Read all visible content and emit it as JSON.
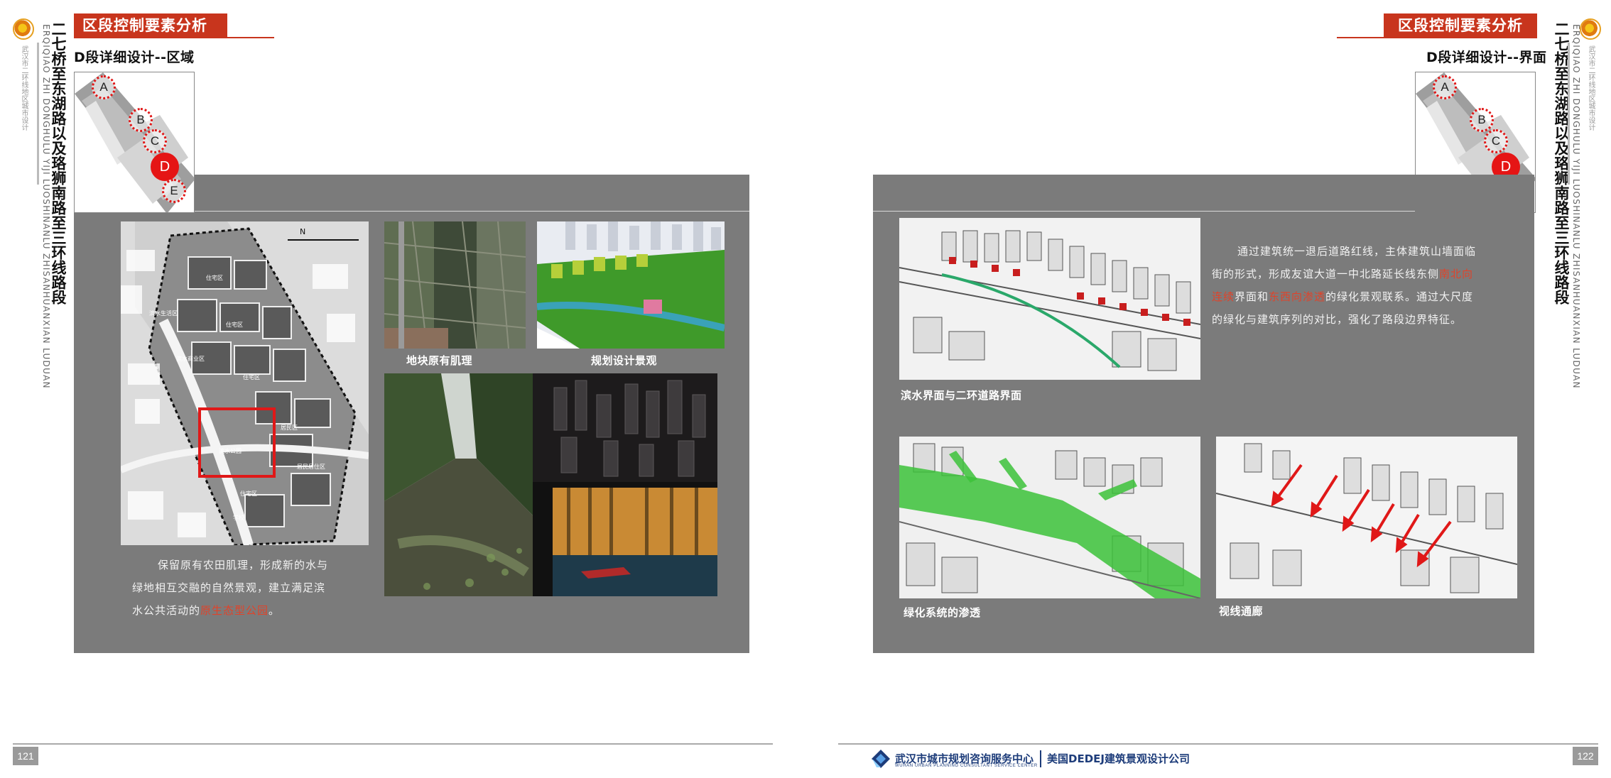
{
  "left_page": {
    "side": {
      "org_small": "武汉市二环线地区城市设计",
      "title": "二七桥至东湖路以及珞狮南路至三环线路段",
      "title_latin": "ERQIQIAO ZHI DONGHULU YIJI LUOSHINANLU ZHISANHUANXIAN LUDUAN"
    },
    "badge": "区段控制要素分析",
    "subtitle": "D段详细设计--区域",
    "keymap_markers": [
      "A",
      "B",
      "C",
      "D",
      "E"
    ],
    "plan_labels": [
      "住宅区",
      "滨水生活区",
      "住宅区",
      "滨水商业区",
      "住宅区",
      "滨水公园",
      "居民区",
      "居民居住区",
      "住宅区",
      "学校"
    ],
    "captions": {
      "original_texture": "地块原有肌理",
      "planned_landscape": "规划设计景观"
    },
    "paragraph": {
      "line1": "保留原有农田肌理，形成新的水与",
      "line2": "绿地相互交融的自然景观，建立满足滨",
      "line3_pre": "水公共活动的",
      "line3_hl": "原生态型公园",
      "line3_post": "。"
    },
    "page_number": "121"
  },
  "right_page": {
    "side": {
      "org_small": "武汉市二环线地区城市设计",
      "title": "二七桥至东湖路以及珞狮南路至三环线路段",
      "title_latin": "ERQIQIAO ZHI DONGHULU YIJI LUOSHINANLU ZHISANHUANXIAN LUDUAN"
    },
    "badge": "区段控制要素分析",
    "subtitle": "D段详细设计--界面",
    "keymap_markers": [
      "A",
      "B",
      "C",
      "D",
      "E"
    ],
    "captions": {
      "waterfront": "滨水界面与二环道路界面",
      "green_system": "绿化系统的渗透",
      "sight_corridor": "视线通廊"
    },
    "paragraph": {
      "line1": "通过建筑统一退后道路红线，主体建筑山墙面临",
      "line2_pre": "街的形式，形成友谊大道一中北路延长线东侧",
      "line2_hl": "南北向",
      "line3_hl": "连续",
      "line3_mid": "界面和",
      "line3_hl2": "东西向渗透",
      "line3_post": "的绿化景观联系。通过大尺度",
      "line4": "的绿化与建筑序列的对比，强化了路段边界特征。"
    },
    "footer": {
      "org_name": "武汉市城市规划咨询服务中心",
      "org_sub": "WUHAN URBAN PLANNING CONSULTANT SERVICE CENTER",
      "firm_name": "美国DEDEJ建筑景观设计公司"
    },
    "page_number": "122"
  },
  "colors": {
    "accent_red": "#c8351d",
    "panel_grey": "#7b7b7b",
    "highlight_red": "#e0432a",
    "footer_blue": "#1d3c7a"
  }
}
